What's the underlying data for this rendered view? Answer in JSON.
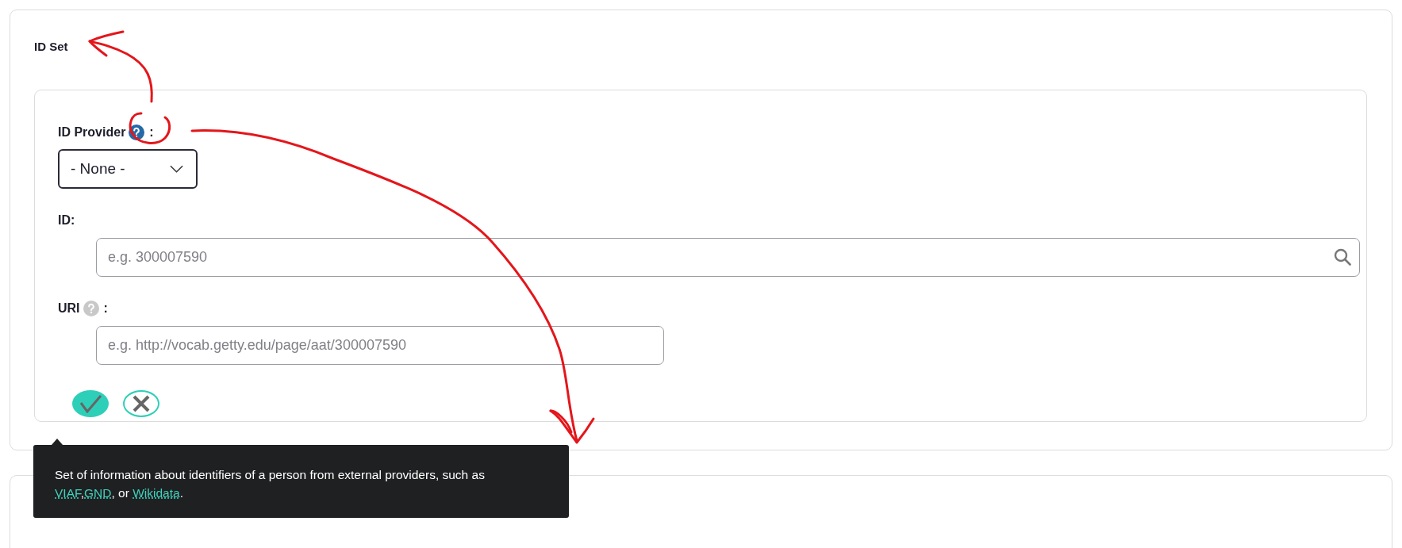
{
  "section": {
    "title": "ID Set"
  },
  "fields": [
    {
      "kind": "select",
      "label": "ID Provider",
      "help_active": true,
      "suffix": ":",
      "value": "- None -"
    },
    {
      "kind": "search",
      "label": "ID:",
      "placeholder": "e.g. 300007590"
    },
    {
      "kind": "text",
      "label": "URI",
      "help_active": false,
      "suffix": ":",
      "placeholder": "e.g. http://vocab.getty.edu/page/aat/300007590"
    }
  ],
  "actions": [
    {
      "kind": "confirm"
    },
    {
      "kind": "cancel"
    }
  ],
  "tooltip": {
    "parts": [
      {
        "kind": "text",
        "text": "Set of information about identifiers of a person from external providers, such as "
      },
      {
        "kind": "link",
        "text": "VIAF"
      },
      {
        "kind": "text",
        "text": ","
      },
      {
        "kind": "link",
        "text": "GND"
      },
      {
        "kind": "text",
        "text": ", or "
      },
      {
        "kind": "link",
        "text": "Wikidata"
      },
      {
        "kind": "text",
        "text": "."
      }
    ]
  }
}
